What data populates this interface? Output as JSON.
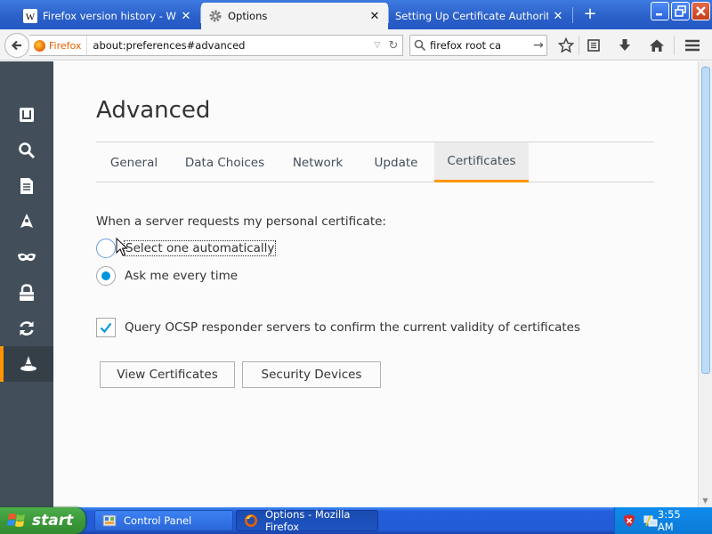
{
  "tabs": [
    {
      "title": "Firefox version history - Wikip...",
      "icon": "wikipedia-icon",
      "active": false
    },
    {
      "title": "Options",
      "icon": "gear-icon",
      "active": true
    },
    {
      "title": "Setting Up Certificate Authorities (...",
      "icon": "none",
      "active": false
    }
  ],
  "navbar": {
    "identity_label": "Firefox",
    "url": "about:preferences#advanced",
    "search_value": "firefox root ca"
  },
  "sidebar": {
    "items": [
      {
        "name": "general",
        "icon": "panel-icon"
      },
      {
        "name": "search",
        "icon": "search-icon"
      },
      {
        "name": "content",
        "icon": "document-icon"
      },
      {
        "name": "applications",
        "icon": "rocket-icon"
      },
      {
        "name": "privacy",
        "icon": "mask-icon"
      },
      {
        "name": "security",
        "icon": "lock-icon"
      },
      {
        "name": "sync",
        "icon": "sync-icon"
      },
      {
        "name": "advanced",
        "icon": "wizard-hat-icon",
        "active": true
      }
    ]
  },
  "page": {
    "title": "Advanced",
    "subtabs": [
      "General",
      "Data Choices",
      "Network",
      "Update",
      "Certificates"
    ],
    "selected_subtab": "Certificates",
    "cert_prompt": "When a server requests my personal certificate:",
    "radio_auto": "Select one automatically",
    "radio_ask": "Ask me every time",
    "selected_radio": "Ask me every time",
    "ocsp_label": "Query OCSP responder servers to confirm the current validity of certificates",
    "ocsp_checked": true,
    "view_certs_label": "View Certificates",
    "security_devices_label": "Security Devices"
  },
  "taskbar": {
    "start_label": "start",
    "tasks": [
      {
        "label": "Control Panel",
        "icon": "control-panel-icon"
      },
      {
        "label": "Options - Mozilla Firefox",
        "icon": "firefox-icon",
        "active": true
      }
    ],
    "clock": "3:55 AM"
  },
  "colors": {
    "accent": "#ff9500",
    "checked_blue": "#0095dd",
    "sidebar_bg": "#424f5a",
    "titlebar_blue": "#2a5fc8",
    "start_green": "#3c9a3a"
  }
}
